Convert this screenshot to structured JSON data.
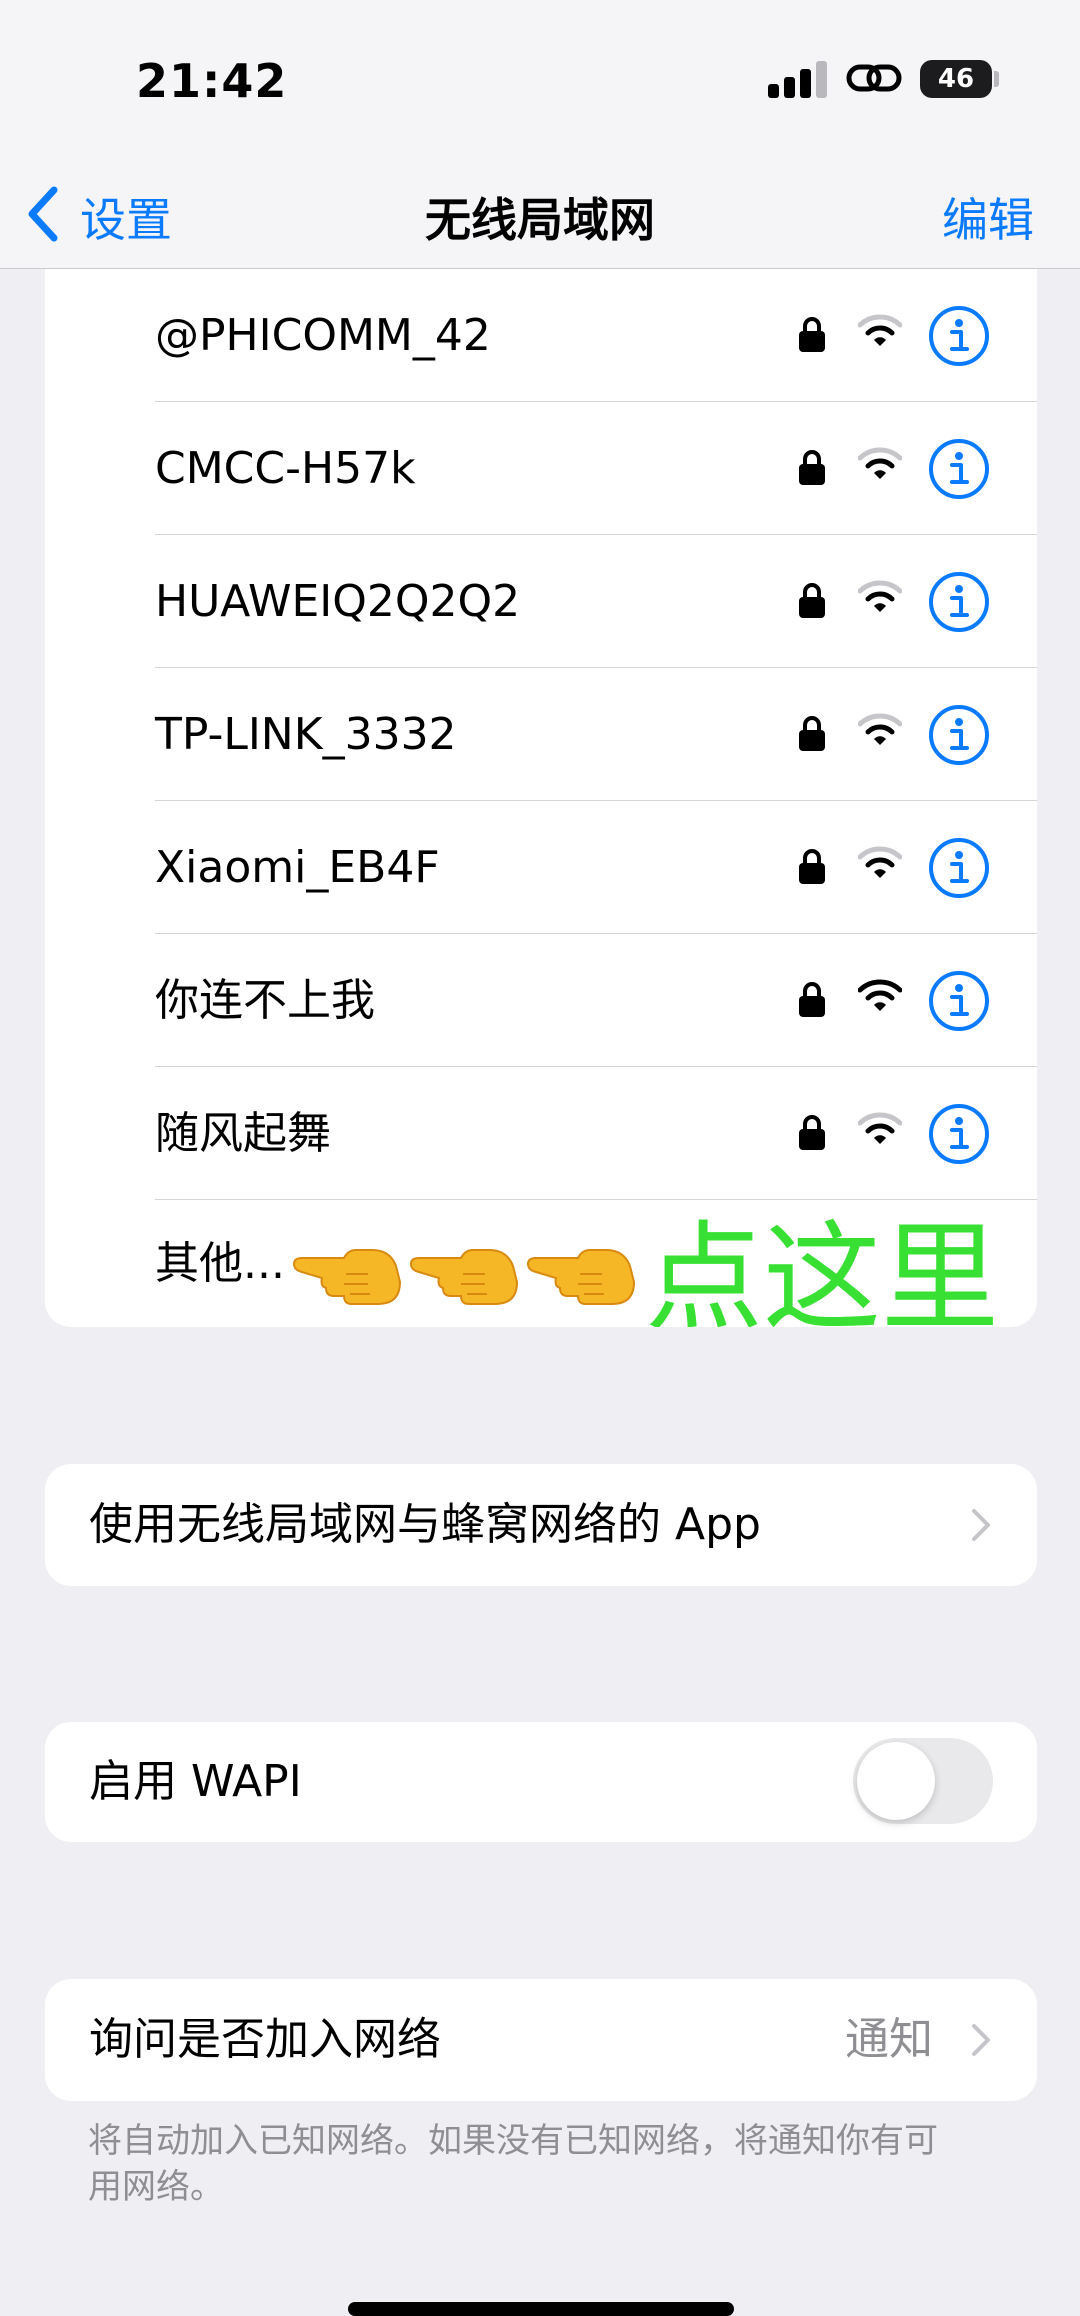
{
  "status_bar": {
    "time": "21:42",
    "battery_percent": "46"
  },
  "nav": {
    "back_label": "设置",
    "title": "无线局域网",
    "edit_label": "编辑"
  },
  "networks": [
    {
      "name": "@PHICOMM_42"
    },
    {
      "name": "CMCC-H57k"
    },
    {
      "name": "HUAWEIQ2Q2Q2"
    },
    {
      "name": "TP-LINK_3332"
    },
    {
      "name": "Xiaomi_EB4F"
    },
    {
      "name": "你连不上我"
    },
    {
      "name": "随风起舞"
    }
  ],
  "other": {
    "label": "其他...",
    "annotation": "点这里"
  },
  "apps_row": {
    "label": "使用无线局域网与蜂窝网络的 App"
  },
  "wapi_row": {
    "label": "启用 WAPI",
    "enabled": false
  },
  "ask_row": {
    "label": "询问是否加入网络",
    "value": "通知"
  },
  "footnote": "将自动加入已知网络。如果没有已知网络，将通知你有可用网络。",
  "colors": {
    "accent": "#0a7aff",
    "annotation": "#38e034"
  }
}
